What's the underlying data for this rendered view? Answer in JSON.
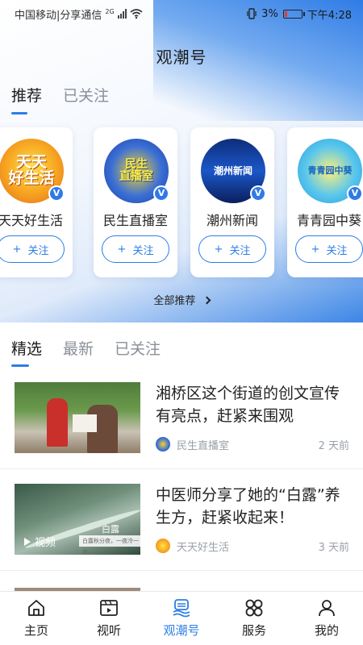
{
  "status_bar": {
    "carrier": "中国移动|分享通信",
    "network": "2G",
    "battery": "3%",
    "time": "下午4:28",
    "battery_color": "#e53935"
  },
  "page_title": "观潮号",
  "top_tabs": [
    {
      "label": "推荐",
      "active": true
    },
    {
      "label": "已关注",
      "active": false
    }
  ],
  "cards": [
    {
      "name": "天天好生活",
      "logo_text": "天天\n好生活",
      "follow_label": "关注",
      "plus": "+",
      "verified": "V",
      "logo_icon": "tiantian-logo"
    },
    {
      "name": "民生直播室",
      "logo_text": "民生\n直播室",
      "follow_label": "关注",
      "plus": "+",
      "verified": "V",
      "logo_icon": "minsheng-logo"
    },
    {
      "name": "潮州新闻",
      "logo_text": "潮州新闻",
      "follow_label": "关注",
      "plus": "+",
      "verified": "V",
      "logo_icon": "chaozhou-news-logo"
    },
    {
      "name": "青青园中葵",
      "logo_text": "青青园中葵",
      "follow_label": "关注",
      "plus": "+",
      "verified": "V",
      "logo_icon": "qingqing-logo"
    }
  ],
  "all_recommendations": "全部推荐",
  "section_tabs": [
    {
      "label": "精选",
      "active": true
    },
    {
      "label": "最新",
      "active": false
    },
    {
      "label": "已关注",
      "active": false
    }
  ],
  "articles": [
    {
      "title": "湘桥区这个街道的创文宣传有亮点，赶紧来围观",
      "source": "民生直播室",
      "time": "2 天前",
      "video_label": ""
    },
    {
      "title": "中医师分享了她的“白露”养生方，赶紧收起来！",
      "source": "天天好生活",
      "time": "3 天前",
      "video_label": "视频",
      "thumb_caption": "白露",
      "thumb_band_text": "白露秋分夜，一夜冷一夜。"
    }
  ],
  "bottom_nav": [
    {
      "label": "主页",
      "icon": "home-icon",
      "active": false
    },
    {
      "label": "视听",
      "icon": "video-icon",
      "active": false
    },
    {
      "label": "观潮号",
      "icon": "guanchao-icon",
      "active": true
    },
    {
      "label": "服务",
      "icon": "services-icon",
      "active": false
    },
    {
      "label": "我的",
      "icon": "profile-icon",
      "active": false
    }
  ],
  "colors": {
    "accent": "#2c7de6",
    "header_blue": "#2f7ce6"
  }
}
